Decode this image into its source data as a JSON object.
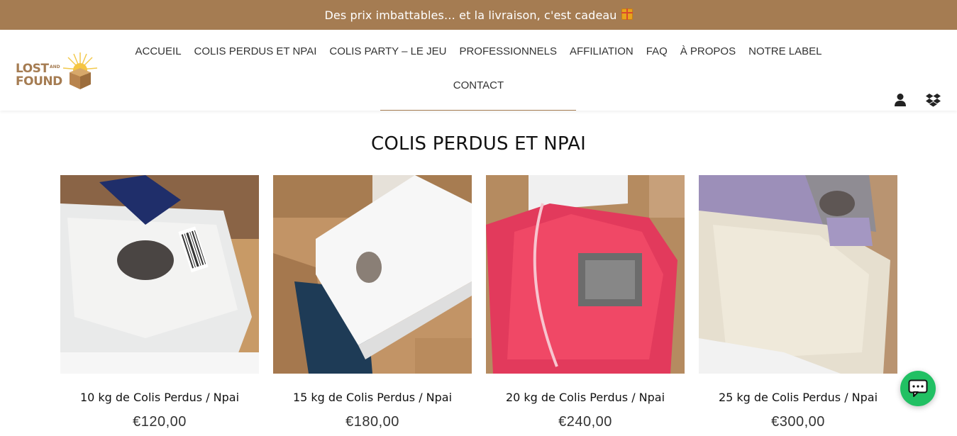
{
  "announcement": {
    "text": "Des prix imbattables… et la livraison, c'est cadeau",
    "icon": "gift-icon"
  },
  "logo": {
    "line1": "LOST",
    "line2": "FOUND",
    "small": "AND",
    "brand_color": "#a57c52"
  },
  "nav": {
    "items": [
      "ACCUEIL",
      "COLIS PERDUS ET NPAI",
      "COLIS PARTY – LE JEU",
      "PROFESSIONNELS",
      "AFFILIATION",
      "FAQ",
      "À PROPOS",
      "NOTRE LABEL"
    ],
    "contact": "CONTACT",
    "active": "COLIS PERDUS ET NPAI"
  },
  "header_icons": {
    "account": "user-icon",
    "cart": "box-icon"
  },
  "section": {
    "title": "COLIS PERDUS ET NPAI"
  },
  "products": [
    {
      "name": "10 kg de Colis Perdus / Npai",
      "price": "€120,00"
    },
    {
      "name": "15 kg de Colis Perdus / Npai",
      "price": "€180,00"
    },
    {
      "name": "20 kg de Colis Perdus / Npai",
      "price": "€240,00"
    },
    {
      "name": "25 kg de Colis Perdus / Npai",
      "price": "€300,00"
    }
  ],
  "chat": {
    "icon": "chat-icon",
    "color": "#21c063"
  }
}
